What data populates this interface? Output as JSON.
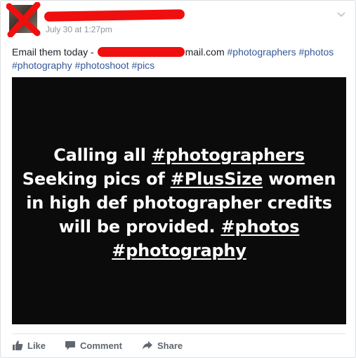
{
  "post": {
    "timestamp": "July 30 at 1:27pm",
    "text_prefix": "Email them today - ",
    "email_suffix": "mail.com",
    "hashtags": [
      "#photographers",
      "#photos",
      "#photography",
      "#photoshoot",
      "#pics"
    ]
  },
  "image": {
    "lines": [
      [
        "Calling all ",
        "#photographers"
      ],
      [
        "Seeking pics of ",
        "#PlusSize",
        " women"
      ],
      [
        "in high def photographer credits"
      ],
      [
        "will be provided. ",
        "#photos"
      ],
      [
        "#photography"
      ]
    ]
  },
  "actions": {
    "like": "Like",
    "comment": "Comment",
    "share": "Share"
  },
  "colors": {
    "redaction": "#f00f0f",
    "link": "#365899",
    "image_bg": "#0b0b0b"
  }
}
